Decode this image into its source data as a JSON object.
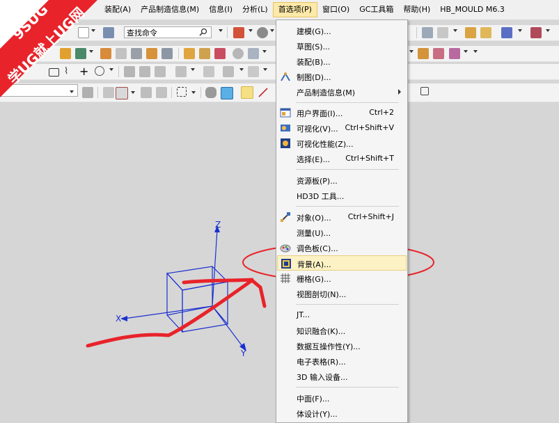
{
  "watermark": {
    "line1": "9SUG",
    "line2": "学UG就上UG网"
  },
  "menubar": {
    "items": [
      "装配(A)",
      "产品制造信息(M)",
      "信息(I)",
      "分析(L)",
      "首选项(P)",
      "窗口(O)",
      "GC工具箱",
      "帮助(H)",
      "HB_MOULD M6.3"
    ]
  },
  "toolbar": {
    "search_value": "查找命令"
  },
  "dropdown": {
    "items": [
      {
        "label": "建模(G)...",
        "shortcut": ""
      },
      {
        "label": "草图(S)...",
        "shortcut": ""
      },
      {
        "label": "装配(B)...",
        "shortcut": ""
      },
      {
        "label": "制图(D)...",
        "shortcut": ""
      },
      {
        "label": "产品制造信息(M)",
        "shortcut": ""
      },
      {
        "label": "用户界面(I)...",
        "shortcut": "Ctrl+2"
      },
      {
        "label": "可视化(V)...",
        "shortcut": "Ctrl+Shift+V"
      },
      {
        "label": "可视化性能(Z)...",
        "shortcut": ""
      },
      {
        "label": "选择(E)...",
        "shortcut": "Ctrl+Shift+T"
      },
      {
        "label": "资源板(P)...",
        "shortcut": ""
      },
      {
        "label": "HD3D 工具...",
        "shortcut": ""
      },
      {
        "label": "对象(O)...",
        "shortcut": "Ctrl+Shift+J"
      },
      {
        "label": "测量(U)...",
        "shortcut": ""
      },
      {
        "label": "调色板(C)...",
        "shortcut": ""
      },
      {
        "label": "背景(A)...",
        "shortcut": ""
      },
      {
        "label": "栅格(G)...",
        "shortcut": ""
      },
      {
        "label": "视图剖切(N)...",
        "shortcut": ""
      },
      {
        "label": "JT...",
        "shortcut": ""
      },
      {
        "label": "知识融合(K)...",
        "shortcut": ""
      },
      {
        "label": "数据互操作性(Y)...",
        "shortcut": ""
      },
      {
        "label": "电子表格(R)...",
        "shortcut": ""
      },
      {
        "label": "3D 输入设备...",
        "shortcut": ""
      },
      {
        "label": "中面(F)...",
        "shortcut": ""
      },
      {
        "label": "体设计(Y)...",
        "shortcut": ""
      }
    ]
  },
  "triad": {
    "z": "Z",
    "x": "X",
    "y": "Y"
  },
  "colors": {
    "annotation": "#e8232a",
    "triad": "#1a2fd0",
    "highlight": "#fdf2c5"
  }
}
